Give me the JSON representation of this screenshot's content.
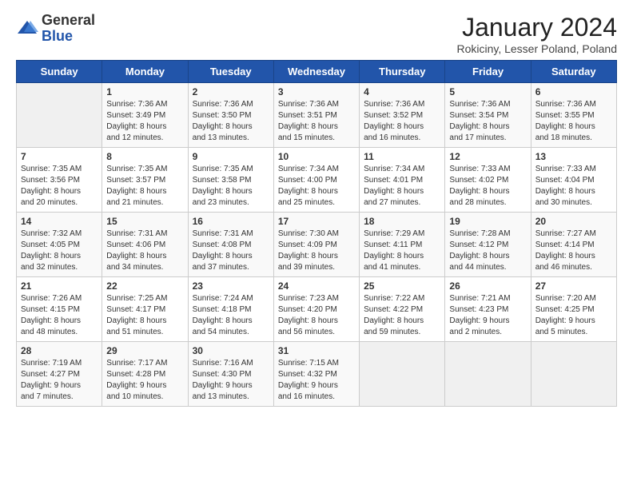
{
  "header": {
    "logo_general": "General",
    "logo_blue": "Blue",
    "title": "January 2024",
    "subtitle": "Rokiciny, Lesser Poland, Poland"
  },
  "days_of_week": [
    "Sunday",
    "Monday",
    "Tuesday",
    "Wednesday",
    "Thursday",
    "Friday",
    "Saturday"
  ],
  "weeks": [
    [
      {
        "day": "",
        "info": ""
      },
      {
        "day": "1",
        "info": "Sunrise: 7:36 AM\nSunset: 3:49 PM\nDaylight: 8 hours\nand 12 minutes."
      },
      {
        "day": "2",
        "info": "Sunrise: 7:36 AM\nSunset: 3:50 PM\nDaylight: 8 hours\nand 13 minutes."
      },
      {
        "day": "3",
        "info": "Sunrise: 7:36 AM\nSunset: 3:51 PM\nDaylight: 8 hours\nand 15 minutes."
      },
      {
        "day": "4",
        "info": "Sunrise: 7:36 AM\nSunset: 3:52 PM\nDaylight: 8 hours\nand 16 minutes."
      },
      {
        "day": "5",
        "info": "Sunrise: 7:36 AM\nSunset: 3:54 PM\nDaylight: 8 hours\nand 17 minutes."
      },
      {
        "day": "6",
        "info": "Sunrise: 7:36 AM\nSunset: 3:55 PM\nDaylight: 8 hours\nand 18 minutes."
      }
    ],
    [
      {
        "day": "7",
        "info": "Sunrise: 7:35 AM\nSunset: 3:56 PM\nDaylight: 8 hours\nand 20 minutes."
      },
      {
        "day": "8",
        "info": "Sunrise: 7:35 AM\nSunset: 3:57 PM\nDaylight: 8 hours\nand 21 minutes."
      },
      {
        "day": "9",
        "info": "Sunrise: 7:35 AM\nSunset: 3:58 PM\nDaylight: 8 hours\nand 23 minutes."
      },
      {
        "day": "10",
        "info": "Sunrise: 7:34 AM\nSunset: 4:00 PM\nDaylight: 8 hours\nand 25 minutes."
      },
      {
        "day": "11",
        "info": "Sunrise: 7:34 AM\nSunset: 4:01 PM\nDaylight: 8 hours\nand 27 minutes."
      },
      {
        "day": "12",
        "info": "Sunrise: 7:33 AM\nSunset: 4:02 PM\nDaylight: 8 hours\nand 28 minutes."
      },
      {
        "day": "13",
        "info": "Sunrise: 7:33 AM\nSunset: 4:04 PM\nDaylight: 8 hours\nand 30 minutes."
      }
    ],
    [
      {
        "day": "14",
        "info": "Sunrise: 7:32 AM\nSunset: 4:05 PM\nDaylight: 8 hours\nand 32 minutes."
      },
      {
        "day": "15",
        "info": "Sunrise: 7:31 AM\nSunset: 4:06 PM\nDaylight: 8 hours\nand 34 minutes."
      },
      {
        "day": "16",
        "info": "Sunrise: 7:31 AM\nSunset: 4:08 PM\nDaylight: 8 hours\nand 37 minutes."
      },
      {
        "day": "17",
        "info": "Sunrise: 7:30 AM\nSunset: 4:09 PM\nDaylight: 8 hours\nand 39 minutes."
      },
      {
        "day": "18",
        "info": "Sunrise: 7:29 AM\nSunset: 4:11 PM\nDaylight: 8 hours\nand 41 minutes."
      },
      {
        "day": "19",
        "info": "Sunrise: 7:28 AM\nSunset: 4:12 PM\nDaylight: 8 hours\nand 44 minutes."
      },
      {
        "day": "20",
        "info": "Sunrise: 7:27 AM\nSunset: 4:14 PM\nDaylight: 8 hours\nand 46 minutes."
      }
    ],
    [
      {
        "day": "21",
        "info": "Sunrise: 7:26 AM\nSunset: 4:15 PM\nDaylight: 8 hours\nand 48 minutes."
      },
      {
        "day": "22",
        "info": "Sunrise: 7:25 AM\nSunset: 4:17 PM\nDaylight: 8 hours\nand 51 minutes."
      },
      {
        "day": "23",
        "info": "Sunrise: 7:24 AM\nSunset: 4:18 PM\nDaylight: 8 hours\nand 54 minutes."
      },
      {
        "day": "24",
        "info": "Sunrise: 7:23 AM\nSunset: 4:20 PM\nDaylight: 8 hours\nand 56 minutes."
      },
      {
        "day": "25",
        "info": "Sunrise: 7:22 AM\nSunset: 4:22 PM\nDaylight: 8 hours\nand 59 minutes."
      },
      {
        "day": "26",
        "info": "Sunrise: 7:21 AM\nSunset: 4:23 PM\nDaylight: 9 hours\nand 2 minutes."
      },
      {
        "day": "27",
        "info": "Sunrise: 7:20 AM\nSunset: 4:25 PM\nDaylight: 9 hours\nand 5 minutes."
      }
    ],
    [
      {
        "day": "28",
        "info": "Sunrise: 7:19 AM\nSunset: 4:27 PM\nDaylight: 9 hours\nand 7 minutes."
      },
      {
        "day": "29",
        "info": "Sunrise: 7:17 AM\nSunset: 4:28 PM\nDaylight: 9 hours\nand 10 minutes."
      },
      {
        "day": "30",
        "info": "Sunrise: 7:16 AM\nSunset: 4:30 PM\nDaylight: 9 hours\nand 13 minutes."
      },
      {
        "day": "31",
        "info": "Sunrise: 7:15 AM\nSunset: 4:32 PM\nDaylight: 9 hours\nand 16 minutes."
      },
      {
        "day": "",
        "info": ""
      },
      {
        "day": "",
        "info": ""
      },
      {
        "day": "",
        "info": ""
      }
    ]
  ]
}
